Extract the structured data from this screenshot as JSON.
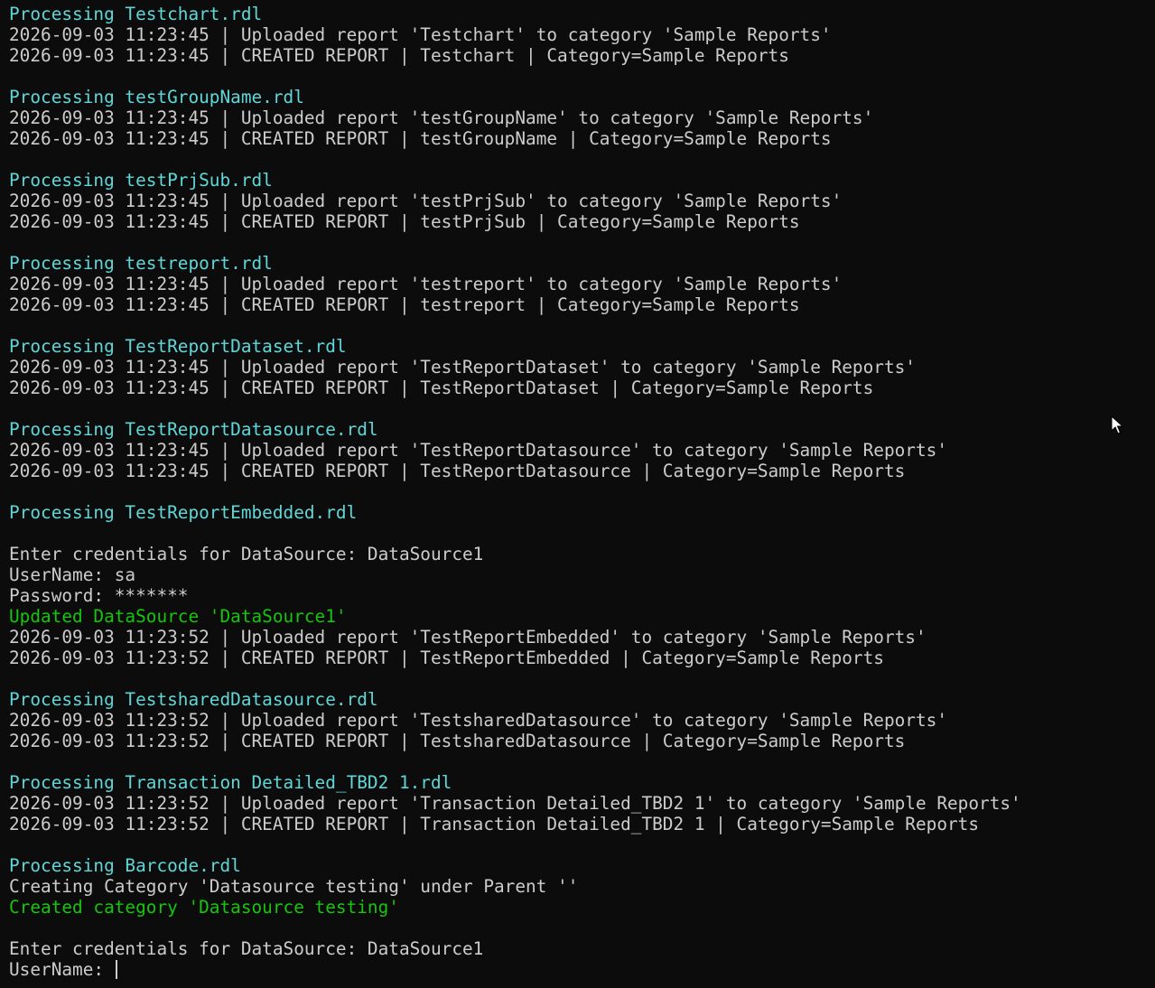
{
  "colors": {
    "background": "#0c0c0c",
    "text": "#cccccc",
    "processing": "#61d6d6",
    "success": "#16c60c"
  },
  "terminal": {
    "lines": [
      {
        "text": "Processing Testchart.rdl",
        "style": "cyan"
      },
      {
        "text": "2026-09-03 11:23:45 | Uploaded report 'Testchart' to category 'Sample Reports'",
        "style": ""
      },
      {
        "text": "2026-09-03 11:23:45 | CREATED REPORT | Testchart | Category=Sample Reports",
        "style": ""
      },
      {
        "text": "",
        "style": ""
      },
      {
        "text": "Processing testGroupName.rdl",
        "style": "cyan"
      },
      {
        "text": "2026-09-03 11:23:45 | Uploaded report 'testGroupName' to category 'Sample Reports'",
        "style": ""
      },
      {
        "text": "2026-09-03 11:23:45 | CREATED REPORT | testGroupName | Category=Sample Reports",
        "style": ""
      },
      {
        "text": "",
        "style": ""
      },
      {
        "text": "Processing testPrjSub.rdl",
        "style": "cyan"
      },
      {
        "text": "2026-09-03 11:23:45 | Uploaded report 'testPrjSub' to category 'Sample Reports'",
        "style": ""
      },
      {
        "text": "2026-09-03 11:23:45 | CREATED REPORT | testPrjSub | Category=Sample Reports",
        "style": ""
      },
      {
        "text": "",
        "style": ""
      },
      {
        "text": "Processing testreport.rdl",
        "style": "cyan"
      },
      {
        "text": "2026-09-03 11:23:45 | Uploaded report 'testreport' to category 'Sample Reports'",
        "style": ""
      },
      {
        "text": "2026-09-03 11:23:45 | CREATED REPORT | testreport | Category=Sample Reports",
        "style": ""
      },
      {
        "text": "",
        "style": ""
      },
      {
        "text": "Processing TestReportDataset.rdl",
        "style": "cyan"
      },
      {
        "text": "2026-09-03 11:23:45 | Uploaded report 'TestReportDataset' to category 'Sample Reports'",
        "style": ""
      },
      {
        "text": "2026-09-03 11:23:45 | CREATED REPORT | TestReportDataset | Category=Sample Reports",
        "style": ""
      },
      {
        "text": "",
        "style": ""
      },
      {
        "text": "Processing TestReportDatasource.rdl",
        "style": "cyan"
      },
      {
        "text": "2026-09-03 11:23:45 | Uploaded report 'TestReportDatasource' to category 'Sample Reports'",
        "style": ""
      },
      {
        "text": "2026-09-03 11:23:45 | CREATED REPORT | TestReportDatasource | Category=Sample Reports",
        "style": ""
      },
      {
        "text": "",
        "style": ""
      },
      {
        "text": "Processing TestReportEmbedded.rdl",
        "style": "cyan"
      },
      {
        "text": "",
        "style": ""
      },
      {
        "text": "Enter credentials for DataSource: DataSource1",
        "style": ""
      },
      {
        "text": "UserName: sa",
        "style": ""
      },
      {
        "text": "Password: *******",
        "style": ""
      },
      {
        "text": "Updated DataSource 'DataSource1'",
        "style": "green"
      },
      {
        "text": "2026-09-03 11:23:52 | Uploaded report 'TestReportEmbedded' to category 'Sample Reports'",
        "style": ""
      },
      {
        "text": "2026-09-03 11:23:52 | CREATED REPORT | TestReportEmbedded | Category=Sample Reports",
        "style": ""
      },
      {
        "text": "",
        "style": ""
      },
      {
        "text": "Processing TestsharedDatasource.rdl",
        "style": "cyan"
      },
      {
        "text": "2026-09-03 11:23:52 | Uploaded report 'TestsharedDatasource' to category 'Sample Reports'",
        "style": ""
      },
      {
        "text": "2026-09-03 11:23:52 | CREATED REPORT | TestsharedDatasource | Category=Sample Reports",
        "style": ""
      },
      {
        "text": "",
        "style": ""
      },
      {
        "text": "Processing Transaction Detailed_TBD2 1.rdl",
        "style": "cyan"
      },
      {
        "text": "2026-09-03 11:23:52 | Uploaded report 'Transaction Detailed_TBD2 1' to category 'Sample Reports'",
        "style": ""
      },
      {
        "text": "2026-09-03 11:23:52 | CREATED REPORT | Transaction Detailed_TBD2 1 | Category=Sample Reports",
        "style": ""
      },
      {
        "text": "",
        "style": ""
      },
      {
        "text": "Processing Barcode.rdl",
        "style": "cyan"
      },
      {
        "text": "Creating Category 'Datasource testing' under Parent ''",
        "style": ""
      },
      {
        "text": "Created category 'Datasource testing'",
        "style": "green"
      },
      {
        "text": "",
        "style": ""
      },
      {
        "text": "Enter credentials for DataSource: DataSource1",
        "style": ""
      }
    ],
    "prompt": {
      "label": "UserName: ",
      "value": ""
    }
  },
  "pointer": {
    "icon": "mouse-pointer-icon"
  }
}
